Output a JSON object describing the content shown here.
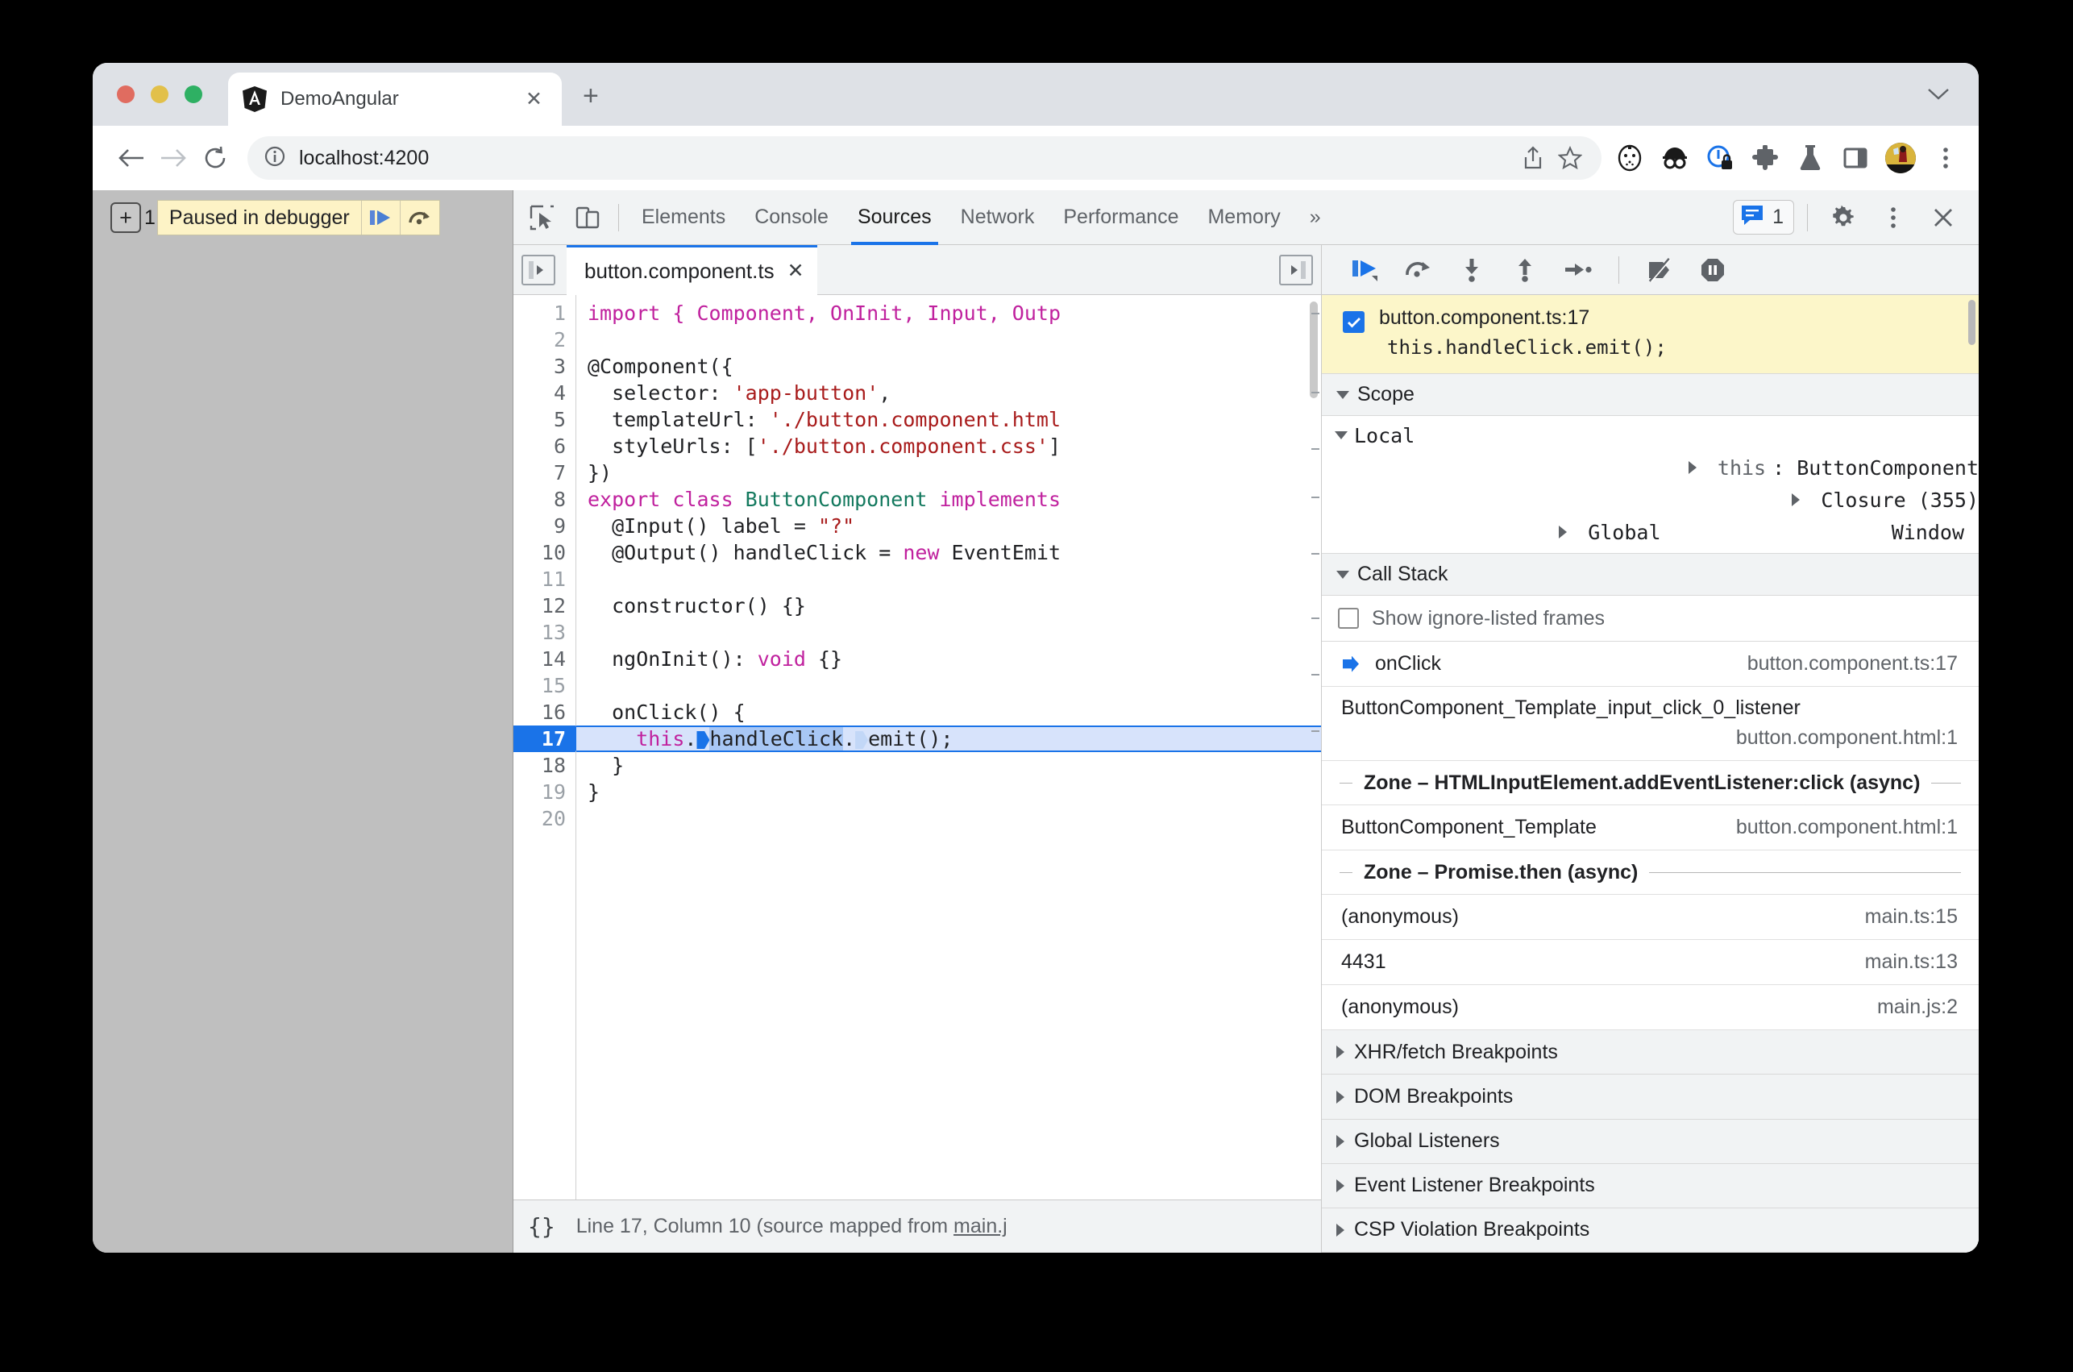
{
  "browser": {
    "tab": {
      "title": "DemoAngular",
      "favicon": "angular-logo",
      "close": "✕"
    },
    "new_tab": "+",
    "url": "localhost:4200",
    "toolbar_icons": [
      "share-icon",
      "bookmark-star-icon",
      "mask-icon",
      "incognito-glasses-icon",
      "privacy-lock-icon",
      "extensions-puzzle-icon",
      "lab-flask-icon",
      "side-panel-icon",
      "profile-avatar",
      "chrome-menu-icon"
    ]
  },
  "viewport": {
    "plus_label": "+",
    "count": "1",
    "paused_label": "Paused in debugger",
    "resume_icon": "resume-script-icon",
    "step_over_icon": "step-over-icon"
  },
  "devtools": {
    "tabs": [
      {
        "label": "Elements",
        "active": false
      },
      {
        "label": "Console",
        "active": false
      },
      {
        "label": "Sources",
        "active": true
      },
      {
        "label": "Network",
        "active": false
      },
      {
        "label": "Performance",
        "active": false
      },
      {
        "label": "Memory",
        "active": false
      }
    ],
    "more_tabs": "»",
    "inspect_icon": "inspect-element-icon",
    "device_icon": "device-toolbar-icon",
    "message_count": "1",
    "message_icon": "console-message-icon",
    "settings_icon": "gear-icon",
    "kebab_icon": "more-options-icon",
    "close_icon": "close-icon"
  },
  "editor": {
    "navigator_icon": "show-navigator-icon",
    "debugger_icon": "show-debugger-icon",
    "file_tab": {
      "name": "button.component.ts",
      "close": "✕"
    },
    "lines": [
      {
        "n": "1",
        "clipped": true
      },
      {
        "n": "2",
        "tokens": []
      },
      {
        "n": "3",
        "tokens": [
          {
            "t": "@Component({",
            "c": ""
          }
        ]
      },
      {
        "n": "4",
        "tokens": [
          {
            "t": "  selector: ",
            "c": ""
          },
          {
            "t": "'app-button'",
            "c": "str"
          },
          {
            "t": ",",
            "c": ""
          }
        ]
      },
      {
        "n": "5",
        "tokens": [
          {
            "t": "  templateUrl: ",
            "c": ""
          },
          {
            "t": "'./button.component.html",
            "c": "str"
          }
        ]
      },
      {
        "n": "6",
        "tokens": [
          {
            "t": "  styleUrls: [",
            "c": ""
          },
          {
            "t": "'./button.component.css'",
            "c": "str"
          },
          {
            "t": "]",
            "c": ""
          }
        ]
      },
      {
        "n": "7",
        "tokens": [
          {
            "t": "})",
            "c": ""
          }
        ]
      },
      {
        "n": "8",
        "tokens": [
          {
            "t": "export class ",
            "c": "kw"
          },
          {
            "t": "ButtonComponent",
            "c": "cls"
          },
          {
            "t": " implements",
            "c": "kw"
          }
        ]
      },
      {
        "n": "9",
        "tokens": [
          {
            "t": "  @Input() label = ",
            "c": ""
          },
          {
            "t": "\"?\"",
            "c": "str"
          }
        ]
      },
      {
        "n": "10",
        "tokens": [
          {
            "t": "  @Output() handleClick = ",
            "c": ""
          },
          {
            "t": "new",
            "c": "kw"
          },
          {
            "t": " EventEmit",
            "c": ""
          }
        ]
      },
      {
        "n": "11",
        "tokens": []
      },
      {
        "n": "12",
        "tokens": [
          {
            "t": "  constructor() {}",
            "c": ""
          }
        ]
      },
      {
        "n": "13",
        "tokens": []
      },
      {
        "n": "14",
        "tokens": [
          {
            "t": "  ngOnInit(): ",
            "c": ""
          },
          {
            "t": "void",
            "c": "kw"
          },
          {
            "t": " {}",
            "c": ""
          }
        ]
      },
      {
        "n": "15",
        "tokens": []
      },
      {
        "n": "16",
        "tokens": [
          {
            "t": "  onClick() {",
            "c": ""
          }
        ]
      },
      {
        "n": "17",
        "current": true
      },
      {
        "n": "18",
        "tokens": [
          {
            "t": "  }",
            "c": ""
          }
        ]
      },
      {
        "n": "19",
        "tokens": [
          {
            "t": "}",
            "c": ""
          }
        ]
      },
      {
        "n": "20",
        "tokens": []
      }
    ],
    "line1_text": "import { Component, OnInit, Input, Outp",
    "current_line_text": "    this.handleClick.emit();",
    "status": {
      "icon": "pretty-print-icon",
      "braces": "{}",
      "text_before": "Line 17, Column 10 (source mapped from ",
      "link": "main.j"
    }
  },
  "debugger": {
    "controls": [
      {
        "name": "resume-button",
        "label": "Resume script execution"
      },
      {
        "name": "step-over-button",
        "label": "Step over next function call"
      },
      {
        "name": "step-into-button",
        "label": "Step into next function call"
      },
      {
        "name": "step-out-button",
        "label": "Step out of current function"
      },
      {
        "name": "step-button",
        "label": "Step"
      },
      {
        "name": "deactivate-breakpoints-button",
        "label": "Deactivate breakpoints"
      },
      {
        "name": "pause-on-exceptions-button",
        "label": "Pause on exceptions"
      }
    ],
    "breakpoint": {
      "checked": true,
      "location": "button.component.ts:17",
      "code": "this.handleClick.emit();"
    },
    "scope": {
      "title": "Scope",
      "expanded": true,
      "groups": [
        {
          "label": "Local",
          "expanded": true,
          "value": ""
        },
        {
          "label": "this: ButtonComponent",
          "name_part": "this",
          "value_part": ": ButtonComponent",
          "indent": true,
          "expanded": false
        },
        {
          "label": "Closure (355)",
          "expanded": false,
          "value": ""
        },
        {
          "label": "Global",
          "expanded": false,
          "value": "Window"
        }
      ]
    },
    "call_stack": {
      "title": "Call Stack",
      "expanded": true,
      "ignore_listed_label": "Show ignore-listed frames",
      "ignore_listed_checked": false,
      "frames": [
        {
          "kind": "frame",
          "current": true,
          "fn": "onClick",
          "loc": "button.component.ts:17"
        },
        {
          "kind": "frame",
          "wrapped": true,
          "fn": "ButtonComponent_Template_input_click_0_listener",
          "loc": "button.component.html:1"
        },
        {
          "kind": "async",
          "label": "Zone – HTMLInputElement.addEventListener:click (async)"
        },
        {
          "kind": "frame",
          "fn": "ButtonComponent_Template",
          "loc": "button.component.html:1"
        },
        {
          "kind": "async",
          "label": "Zone – Promise.then (async)"
        },
        {
          "kind": "frame",
          "fn": "(anonymous)",
          "loc": "main.ts:15"
        },
        {
          "kind": "frame",
          "fn": "4431",
          "loc": "main.ts:13"
        },
        {
          "kind": "frame",
          "fn": "(anonymous)",
          "loc": "main.js:2"
        }
      ]
    },
    "collapsed_sections": [
      {
        "label": "XHR/fetch Breakpoints"
      },
      {
        "label": "DOM Breakpoints"
      },
      {
        "label": "Global Listeners"
      },
      {
        "label": "Event Listener Breakpoints"
      },
      {
        "label": "CSP Violation Breakpoints"
      }
    ]
  },
  "colors": {
    "accent": "#1a73e8",
    "breakpoint_yellow": "#fcf6c9",
    "panel_grey": "#f1f3f4",
    "string_red": "#a81b1b",
    "keyword_magenta": "#c0219e",
    "class_teal": "#13795e"
  }
}
